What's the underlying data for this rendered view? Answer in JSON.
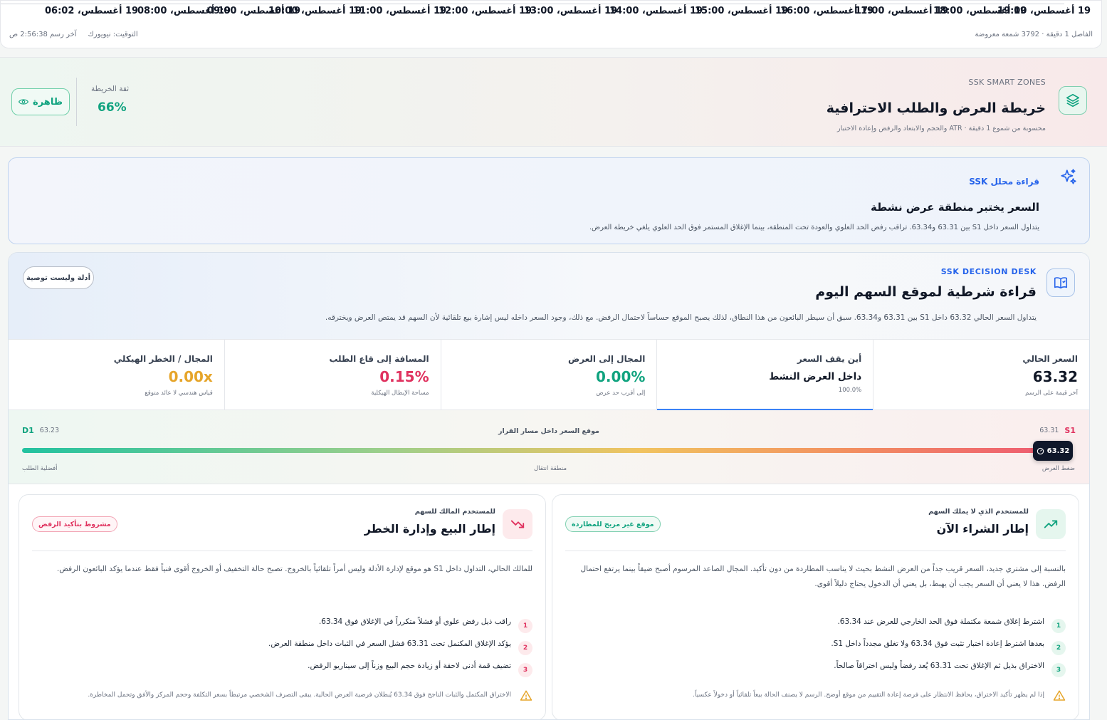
{
  "time_axis": {
    "labels": [
      "19 أغسطس، 06:02",
      "19 أغسطس، 08:00",
      "19 أغسطس، 09:00",
      "19 أغسطس، 10:00",
      "19 أغسطس، 11:00",
      "19 أغسطس، 12:00",
      "19 أغسطس، 13:00",
      "19 أغسطس، 14:00",
      "19 أغسطس، 15:00",
      "19 أغسطس، 16:00",
      "19 أغسطس، 17:00",
      "19 أغسطس، 18:00",
      "19 أغسطس، 19:00"
    ],
    "interval_info": "الفاصل 1 دقيقة · 3792 شمعة معروضة",
    "last_draw": "آخر رسم 2:56:38 ص",
    "timezone": "التوقيت: نيويورك"
  },
  "zones": {
    "eyebrow": "SSK SMART ZONES",
    "title": "خريطة العرض والطلب الاحترافية",
    "subtitle": "محسوبة من شموع 1 دقيقة · ATR والحجم والابتعاد والرفض وإعادة الاختبار",
    "confidence_label": "ثقة الخريطة",
    "confidence_value": "66%",
    "visible_label": "ظاهرة",
    "icon": "layers-icon"
  },
  "analyst": {
    "eyebrow": "قراءة محلل SSK",
    "title": "السعر يختبر منطقة عرض نشطة",
    "body": "يتداول السعر داخل S1 بين 63.31 و63.34. تراقب رفض الحد العلوي والعودة تحت المنطقة، بينما الإغلاق المستمر فوق الحد العلوي يلغي خريطة العرض.",
    "icon": "sparkles-icon"
  },
  "desk": {
    "eyebrow": "SSK DECISION DESK",
    "title": "قراءة شرطية لموقع السهم اليوم",
    "body": "يتداول السعر الحالي 63.32 داخل S1 بين 63.31 و63.34. سبق أن سيطر البائعون من هذا النطاق، لذلك يصبح الموقع حساساً لاحتمال الرفض. مع ذلك، وجود السعر داخله ليس إشارة بيع تلقائية لأن السهم قد يمتص العرض ويخترقه.",
    "badge": "أدلة وليست توصية",
    "icon": "book-icon",
    "metrics": [
      {
        "label": "السعر الحالي",
        "value": "63.32",
        "sub": "آخر قيمة على الرسم",
        "tone": "dark"
      },
      {
        "label": "أين يقف السعر",
        "value": "داخل العرض النشط",
        "sub": "100.0%",
        "tone": "position"
      },
      {
        "label": "المجال إلى العرض",
        "value": "0.00%",
        "sub": "إلى أقرب حد عرض",
        "tone": "green"
      },
      {
        "label": "المسافة إلى قاع الطلب",
        "value": "0.15%",
        "sub": "مساحة الإبطال الهيكلية",
        "tone": "red"
      },
      {
        "label": "المجال / الخطر الهيكلي",
        "value": "0.00x",
        "sub": "قياس هندسي لا عائد متوقع",
        "tone": "amber"
      }
    ],
    "path": {
      "caption": "موقع السعر داخل مسار القرار",
      "left_code": "D1",
      "left_value": "63.23",
      "right_code": "S1",
      "right_value": "63.31",
      "marker_value": "63.32",
      "position_fraction": 1.0,
      "zone_labels": [
        "ضغط العرض",
        "منطقة انتقال",
        "أفضلية الطلب"
      ],
      "colors": {
        "demand": "#10a37f",
        "supply": "#e0325f"
      }
    },
    "buy": {
      "eyebrow": "للمستخدم الذي لا يملك السهم",
      "title": "إطار الشراء الآن",
      "tag": "موقع غير مربح للمطاردة",
      "body": "بالنسبة إلى مشتري جديد، السعر قريب جداً من العرض النشط بحيث لا يناسب المطاردة من دون تأكيد. المجال الصاعد المرسوم أصبح ضيقاً بينما يرتفع احتمال الرفض. هذا لا يعني أن السعر يجب أن يهبط، بل يعني أن الدخول يحتاج دليلاً أقوى.",
      "items": [
        "اشترط إغلاق شمعة مكتملة فوق الحد الخارجي للعرض عند 63.34.",
        "بعدها اشترط إعادة اختبار تثبت فوق 63.34 ولا تغلق مجدداً داخل S1.",
        "الاختراق بذيل ثم الإغلاق تحت 63.31 يُعد رفضاً وليس اختراقاً صالحاً."
      ],
      "warning": "إذا لم يظهر تأكيد الاختراق، يحافظ الانتظار على فرصة إعادة التقييم من موقع أوضح. الرسم لا يصنف الحالة بيعاً تلقائياً أو دخولاً عكسياً.",
      "icon": "trending-up-icon"
    },
    "sell": {
      "eyebrow": "للمستخدم المالك للسهم",
      "title": "إطار البيع وإدارة الخطر",
      "tag": "مشروط بتأكيد الرفض",
      "body": "للمالك الحالي، التداول داخل S1 هو موقع لإدارة الأدلة وليس أمراً تلقائياً بالخروج. تصبح حالة التخفيف أو الخروج أقوى فنياً فقط عندما يؤكد البائعون الرفض.",
      "items": [
        "راقب ذيل رفض علوي أو فشلاً متكرراً في الإغلاق فوق 63.34.",
        "يؤكد الإغلاق المكتمل تحت 63.31 فشل السعر في الثبات داخل منطقة العرض.",
        "تضيف قمة أدنى لاحقة أو زيادة حجم البيع وزناً إلى سيناريو الرفض."
      ],
      "warning": "الاختراق المكتمل والثبات الناجح فوق 63.34 يُبطلان فرضية العرض الحالية. يبقى التصرف الشخصي مرتبطاً بسعر التكلفة وحجم المركز والأفق وتحمل المخاطرة.",
      "icon": "trending-down-icon"
    }
  }
}
